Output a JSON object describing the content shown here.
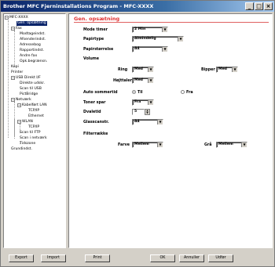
{
  "window": {
    "title": "Brother MFC Fjerninstallations Program - MFC-XXXX"
  },
  "tree": {
    "items": [
      {
        "label": "MFC-XXXX",
        "expander": "−"
      },
      {
        "label": "Gen. opsætning",
        "selected": true
      },
      {
        "label": "Fax",
        "expander": "−"
      },
      {
        "label": "Modtageindst."
      },
      {
        "label": "Afsenderindst."
      },
      {
        "label": "Adressebog"
      },
      {
        "label": "Rapportindst."
      },
      {
        "label": "Andre fax"
      },
      {
        "label": "Opk.begrænsn."
      },
      {
        "label": "Kopi"
      },
      {
        "label": "Printer"
      },
      {
        "label": "USB Direkt I/F",
        "expander": "−"
      },
      {
        "label": "Direkte udskr."
      },
      {
        "label": "Scan til USB"
      },
      {
        "label": "PictBridge"
      },
      {
        "label": "Netværk",
        "expander": "−"
      },
      {
        "label": "Kabelført LAN",
        "expander": "−"
      },
      {
        "label": "TCP/IP"
      },
      {
        "label": "Ethernet"
      },
      {
        "label": "WLAN",
        "expander": "−"
      },
      {
        "label": "TCP/IP"
      },
      {
        "label": "Scan til FTP"
      },
      {
        "label": "Scan i netværk"
      },
      {
        "label": "Tidszone"
      },
      {
        "label": "Grundindst."
      }
    ]
  },
  "panel": {
    "title": "Gen. opsætning",
    "mode_timer": {
      "label": "Mode timer",
      "value": "2 Min"
    },
    "papirtype": {
      "label": "Papirtype",
      "value": "Almindelig"
    },
    "papirstorrelse": {
      "label": "Papirstørrelse",
      "value": "A4"
    },
    "volume": {
      "label": "Volume",
      "ring": {
        "label": "Ring",
        "value": "Med"
      },
      "bipper": {
        "label": "Bipper",
        "value": "Med"
      },
      "hojttaler": {
        "label": "Højttaler",
        "value": "Med"
      }
    },
    "auto_sommertid": {
      "label": "Auto sommertid",
      "on_label": "Til",
      "off_label": "Fra",
      "selected": "Til"
    },
    "toner_spar": {
      "label": "Toner spar",
      "value": "Fra"
    },
    "dvaletid": {
      "label": "Dvaletid",
      "value": "5"
    },
    "glasscanstr": {
      "label": "Glasscanstr.",
      "value": "A4"
    },
    "filterraekke": {
      "label": "Filterrække",
      "farve": {
        "label": "Farve",
        "value": "Mellem"
      },
      "gra": {
        "label": "Grå",
        "value": "Mellem"
      }
    }
  },
  "buttons": {
    "eksport": "Export",
    "import": "Import",
    "print": "Print",
    "ok": "OK",
    "annuller": "Annuller",
    "udfor": "Udfør"
  },
  "colors": {
    "titlebar": "#0a246a",
    "panel_title": "#e03030",
    "selection": "#0a246a"
  }
}
